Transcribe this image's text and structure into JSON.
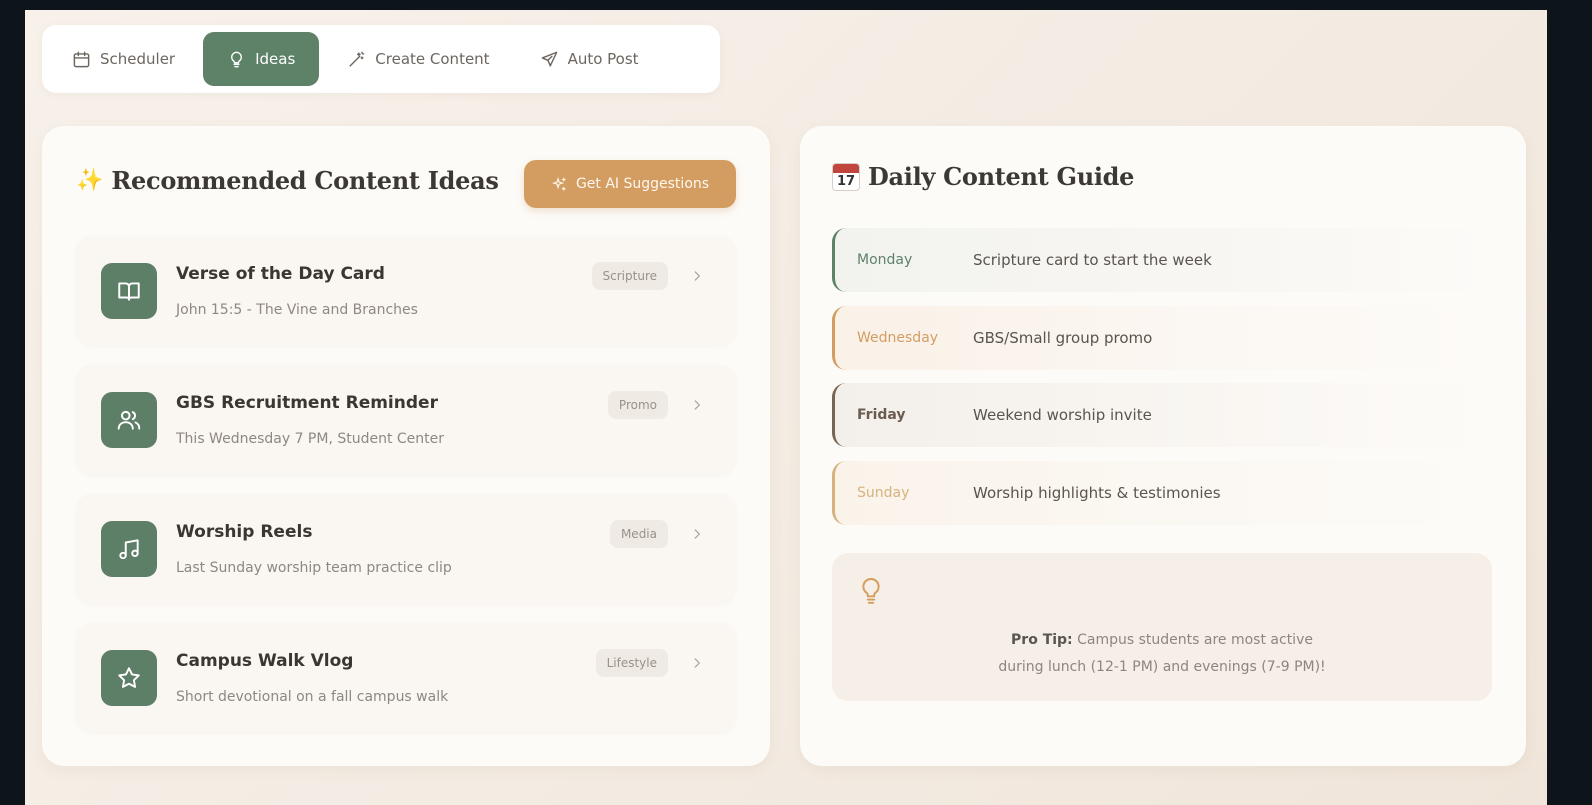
{
  "tabs": [
    {
      "label": "Scheduler",
      "icon": "calendar-icon",
      "active": false
    },
    {
      "label": "Ideas",
      "icon": "lightbulb-icon",
      "active": true
    },
    {
      "label": "Create Content",
      "icon": "magic-wand-icon",
      "active": false
    },
    {
      "label": "Auto Post",
      "icon": "send-icon",
      "active": false
    }
  ],
  "ideas_panel": {
    "title_emoji": "✨",
    "title": "Recommended Content Ideas",
    "ai_button_label": "Get AI Suggestions",
    "items": [
      {
        "title": "Verse of the Day Card",
        "subtitle": "John 15:5 - The Vine and Branches",
        "tag": "Scripture",
        "icon": "book-icon"
      },
      {
        "title": "GBS Recruitment Reminder",
        "subtitle": "This Wednesday 7 PM, Student Center",
        "tag": "Promo",
        "icon": "users-icon"
      },
      {
        "title": "Worship Reels",
        "subtitle": "Last Sunday worship team practice clip",
        "tag": "Media",
        "icon": "music-icon"
      },
      {
        "title": "Campus Walk Vlog",
        "subtitle": "Short devotional on a fall campus walk",
        "tag": "Lifestyle",
        "icon": "star-icon"
      }
    ]
  },
  "guide_panel": {
    "title_emoji_day": "17",
    "title": "Daily Content Guide",
    "days": [
      {
        "day": "Monday",
        "text": "Scripture card to start the week",
        "color": "#5e8268"
      },
      {
        "day": "Wednesday",
        "text": "GBS/Small group promo",
        "color": "#d39d62"
      },
      {
        "day": "Friday",
        "text": "Weekend worship invite",
        "color": "#7a6553"
      },
      {
        "day": "Sunday",
        "text": "Worship highlights & testimonies",
        "color": "#d8b27e"
      }
    ],
    "tip": {
      "label": "Pro Tip:",
      "line1": "Campus students are most active",
      "line2": "during lunch (12-1 PM) and evenings (7-9 PM)!"
    }
  },
  "colors": {
    "accent_green": "#5e8268",
    "accent_orange": "#d39d62",
    "background": "#f5eee6"
  }
}
